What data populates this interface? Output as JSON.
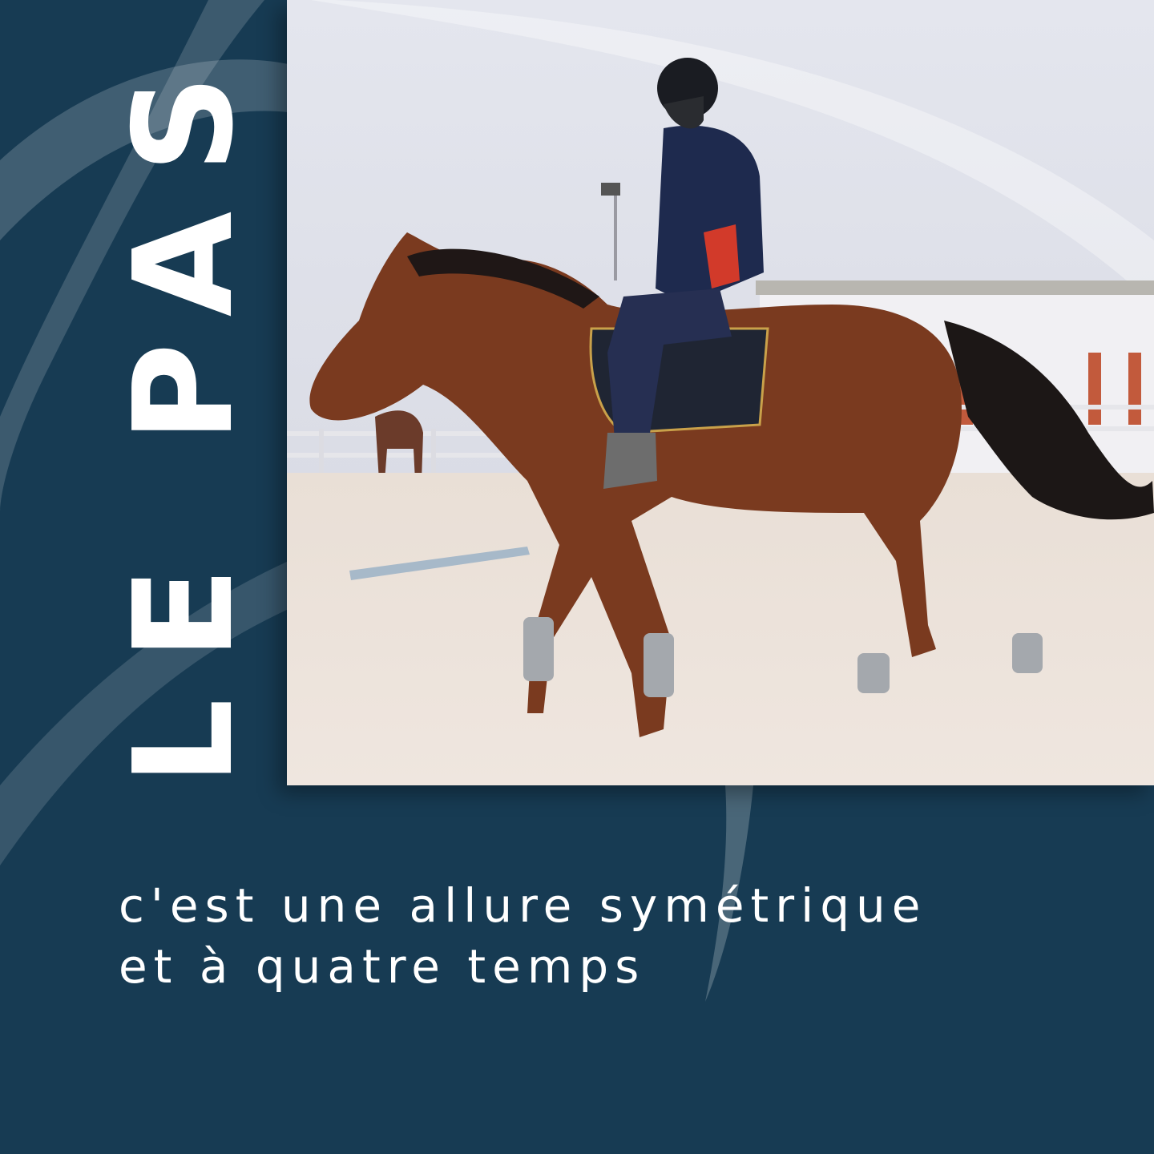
{
  "title": "LE PAS",
  "caption": {
    "line1": "c'est une allure symétrique",
    "line2": "et à quatre temps"
  },
  "colors": {
    "background": "#173b53",
    "text": "#ffffff",
    "swirl": "#ffffff"
  },
  "photo": {
    "subject": "rider-on-bay-horse-in-sand-arena"
  }
}
